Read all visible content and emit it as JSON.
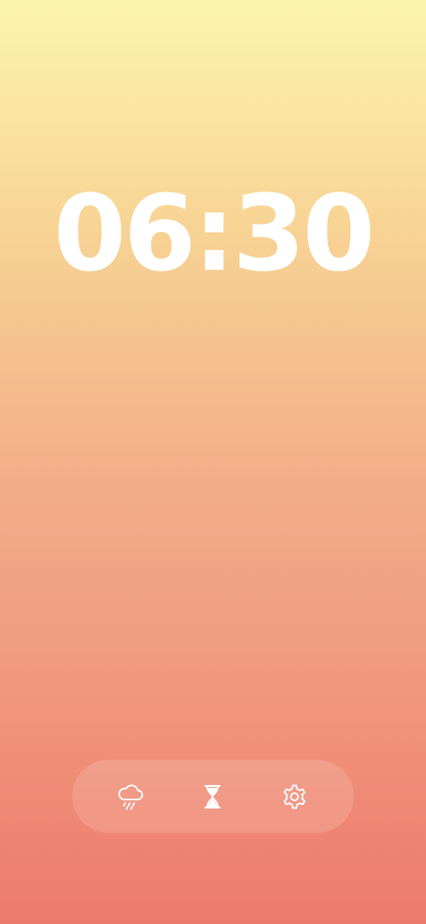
{
  "clock": {
    "time": "06:30"
  },
  "dock": {
    "buttons": [
      {
        "icon": "cloud-rain-icon"
      },
      {
        "icon": "hourglass-icon"
      },
      {
        "icon": "gear-icon"
      }
    ]
  },
  "colors": {
    "gradient_top": "#FCF5AE",
    "gradient_bottom": "#EE7A6C",
    "foreground": "#FFFFFF"
  }
}
